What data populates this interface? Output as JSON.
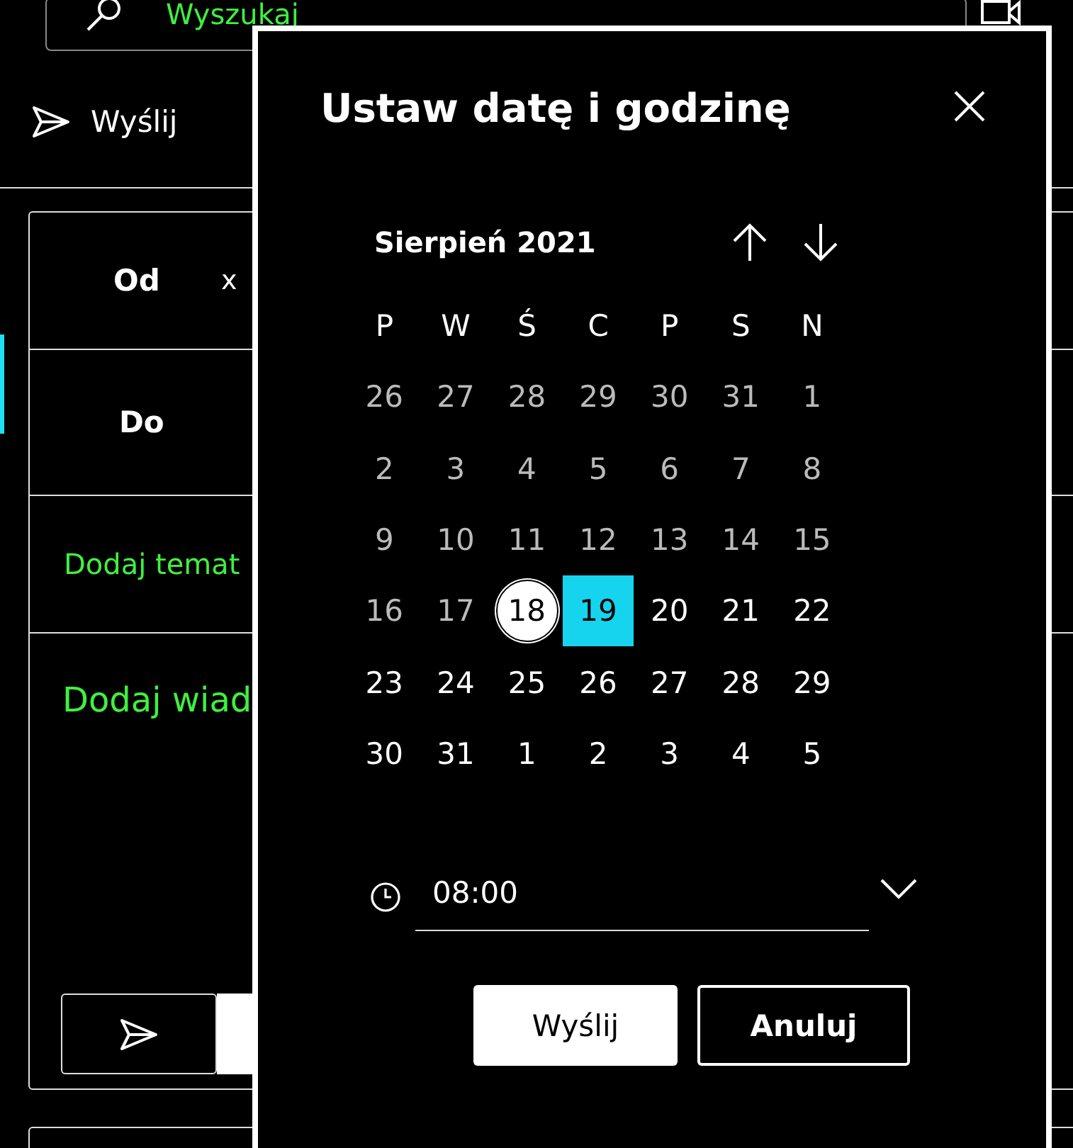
{
  "search": {
    "placeholder": "Wyszukaj"
  },
  "toolbar": {
    "send_label": "Wyślij"
  },
  "compose": {
    "from_label": "Od",
    "from_value": "x",
    "to_label": "Do",
    "subject_placeholder": "Dodaj temat",
    "body_placeholder": "Dodaj wiad"
  },
  "dialog": {
    "title": "Ustaw datę i godzinę",
    "month": "Sierpień 2021",
    "weekdays": [
      "P",
      "W",
      "Ś",
      "C",
      "P",
      "S",
      "N"
    ],
    "weeks": [
      [
        {
          "label": "26",
          "disabled": true,
          "today": false,
          "selected": false
        },
        {
          "label": "27",
          "disabled": true,
          "today": false,
          "selected": false
        },
        {
          "label": "28",
          "disabled": true,
          "today": false,
          "selected": false
        },
        {
          "label": "29",
          "disabled": true,
          "today": false,
          "selected": false
        },
        {
          "label": "30",
          "disabled": true,
          "today": false,
          "selected": false
        },
        {
          "label": "31",
          "disabled": true,
          "today": false,
          "selected": false
        },
        {
          "label": "1",
          "disabled": true,
          "today": false,
          "selected": false
        }
      ],
      [
        {
          "label": "2",
          "disabled": true,
          "today": false,
          "selected": false
        },
        {
          "label": "3",
          "disabled": true,
          "today": false,
          "selected": false
        },
        {
          "label": "4",
          "disabled": true,
          "today": false,
          "selected": false
        },
        {
          "label": "5",
          "disabled": true,
          "today": false,
          "selected": false
        },
        {
          "label": "6",
          "disabled": true,
          "today": false,
          "selected": false
        },
        {
          "label": "7",
          "disabled": true,
          "today": false,
          "selected": false
        },
        {
          "label": "8",
          "disabled": true,
          "today": false,
          "selected": false
        }
      ],
      [
        {
          "label": "9",
          "disabled": true,
          "today": false,
          "selected": false
        },
        {
          "label": "10",
          "disabled": true,
          "today": false,
          "selected": false
        },
        {
          "label": "11",
          "disabled": true,
          "today": false,
          "selected": false
        },
        {
          "label": "12",
          "disabled": true,
          "today": false,
          "selected": false
        },
        {
          "label": "13",
          "disabled": true,
          "today": false,
          "selected": false
        },
        {
          "label": "14",
          "disabled": true,
          "today": false,
          "selected": false
        },
        {
          "label": "15",
          "disabled": true,
          "today": false,
          "selected": false
        }
      ],
      [
        {
          "label": "16",
          "disabled": true,
          "today": false,
          "selected": false
        },
        {
          "label": "17",
          "disabled": true,
          "today": false,
          "selected": false
        },
        {
          "label": "18",
          "disabled": false,
          "today": true,
          "selected": false
        },
        {
          "label": "19",
          "disabled": false,
          "today": false,
          "selected": true
        },
        {
          "label": "20",
          "disabled": false,
          "today": false,
          "selected": false
        },
        {
          "label": "21",
          "disabled": false,
          "today": false,
          "selected": false
        },
        {
          "label": "22",
          "disabled": false,
          "today": false,
          "selected": false
        }
      ],
      [
        {
          "label": "23",
          "disabled": false,
          "today": false,
          "selected": false
        },
        {
          "label": "24",
          "disabled": false,
          "today": false,
          "selected": false
        },
        {
          "label": "25",
          "disabled": false,
          "today": false,
          "selected": false
        },
        {
          "label": "26",
          "disabled": false,
          "today": false,
          "selected": false
        },
        {
          "label": "27",
          "disabled": false,
          "today": false,
          "selected": false
        },
        {
          "label": "28",
          "disabled": false,
          "today": false,
          "selected": false
        },
        {
          "label": "29",
          "disabled": false,
          "today": false,
          "selected": false
        }
      ],
      [
        {
          "label": "30",
          "disabled": false,
          "today": false,
          "selected": false
        },
        {
          "label": "31",
          "disabled": false,
          "today": false,
          "selected": false
        },
        {
          "label": "1",
          "disabled": false,
          "today": false,
          "selected": false
        },
        {
          "label": "2",
          "disabled": false,
          "today": false,
          "selected": false
        },
        {
          "label": "3",
          "disabled": false,
          "today": false,
          "selected": false
        },
        {
          "label": "4",
          "disabled": false,
          "today": false,
          "selected": false
        },
        {
          "label": "5",
          "disabled": false,
          "today": false,
          "selected": false
        }
      ]
    ],
    "time": "08:00",
    "buttons": [
      {
        "label": "Wyślij",
        "kind": "primary"
      },
      {
        "label": "Anuluj",
        "kind": "secondary"
      }
    ]
  }
}
